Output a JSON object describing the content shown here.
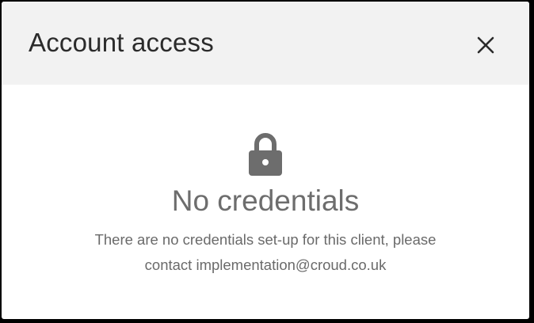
{
  "dialog": {
    "title": "Account access",
    "close_icon": "close-icon"
  },
  "empty_state": {
    "icon": "lock-icon",
    "title": "No credentials",
    "message_line1": "There are no credentials set-up for this client, please",
    "message_line2": "contact implementation@croud.co.uk"
  },
  "colors": {
    "header_background": "#f2f2f2",
    "body_background": "#ffffff",
    "icon": "#6d6d6d",
    "text": "#6a6a6a",
    "title_text": "#2b2b2b"
  }
}
